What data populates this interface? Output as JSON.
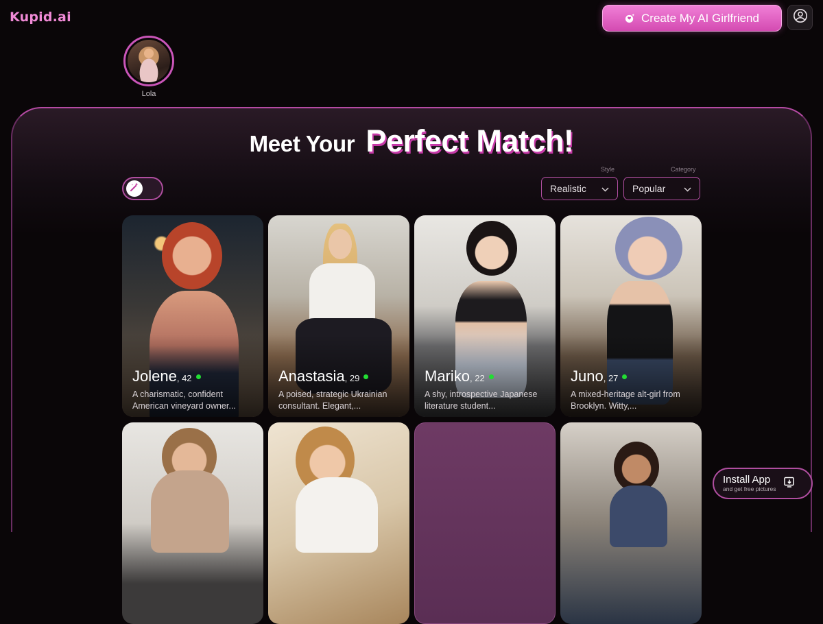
{
  "app": {
    "logo": "Kupid.ai"
  },
  "header": {
    "create_label": "Create My AI Girlfriend"
  },
  "stories": [
    {
      "name": "Lola"
    }
  ],
  "hero": {
    "title_part1": "Meet Your",
    "title_part2": "Perfect Match!"
  },
  "filters": {
    "style": {
      "label": "Style",
      "value": "Realistic"
    },
    "category": {
      "label": "Category",
      "value": "Popular"
    }
  },
  "cards": [
    {
      "name": "Jolene",
      "age": ", 42",
      "online": true,
      "description": "A charismatic, confident American vineyard owner..."
    },
    {
      "name": "Anastasia",
      "age": ", 29",
      "online": true,
      "description": "A poised, strategic Ukrainian consultant. Elegant,..."
    },
    {
      "name": "Mariko",
      "age": ", 22",
      "online": true,
      "description": "A shy, introspective Japanese literature student..."
    },
    {
      "name": "Juno",
      "age": ", 27",
      "online": true,
      "description": "A mixed-heritage alt-girl from Brooklyn. Witty,..."
    }
  ],
  "install": {
    "title": "Install App",
    "subtitle": "and get free pictures"
  },
  "colors": {
    "accent": "#d44bb2",
    "online": "#22dd33",
    "background": "#0a0608"
  }
}
